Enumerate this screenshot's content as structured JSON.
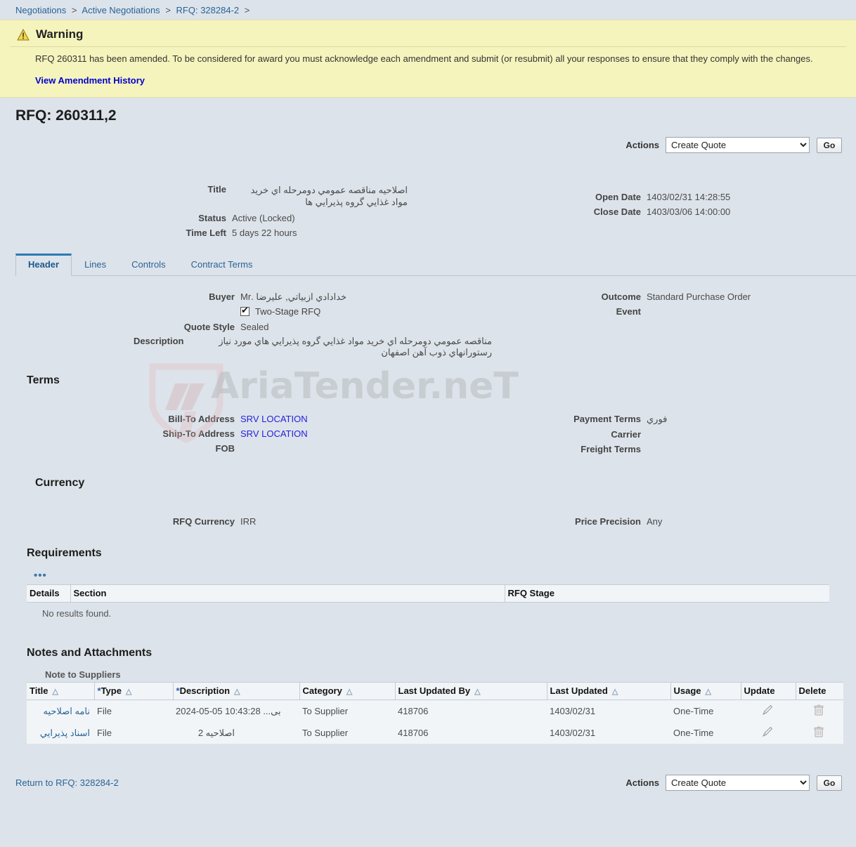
{
  "breadcrumb": {
    "items": [
      {
        "label": "Negotiations"
      },
      {
        "label": "Active Negotiations"
      },
      {
        "label": "RFQ: 328284-2"
      }
    ],
    "separator": ">"
  },
  "warning": {
    "icon": "warning-triangle-icon",
    "heading": "Warning",
    "message": "RFQ 260311 has been amended. To be considered for award you must acknowledge each amendment and submit (or resubmit) all your responses to ensure that they comply with the changes.",
    "link_label": "View Amendment History",
    "background_color": "#f5f4bd"
  },
  "page": {
    "title": "RFQ: 260311,2"
  },
  "actions_top": {
    "label": "Actions",
    "selected": "Create Quote",
    "options": [
      "Create Quote"
    ],
    "go_label": "Go"
  },
  "summary": {
    "left": [
      {
        "label": "Title",
        "value": "اصلاحیه مناقصه عمومي دومرحله اي خريد مواد غذايي گروه پذيرايي ها",
        "rtl": true
      },
      {
        "label": "Status",
        "value": "Active (Locked)",
        "rtl": false
      },
      {
        "label": "Time Left",
        "value": "5 days 22 hours",
        "rtl": false
      }
    ],
    "right": [
      {
        "label": "Open Date",
        "value": "1403/02/31 14:28:55"
      },
      {
        "label": "Close Date",
        "value": "1403/03/06 14:00:00"
      }
    ]
  },
  "tabs": [
    {
      "label": "Header",
      "active": true
    },
    {
      "label": "Lines",
      "active": false
    },
    {
      "label": "Controls",
      "active": false
    },
    {
      "label": "Contract Terms",
      "active": false
    }
  ],
  "header_details": {
    "left": [
      {
        "label": "Buyer",
        "value": "خدادادي ازبياتي, علیرضا .Mr",
        "rtl": true
      },
      {
        "label": "Quote Style",
        "value": "Sealed",
        "rtl": false
      },
      {
        "label": "Description",
        "value": "مناقصه عمومي دومرحله اي خريد مواد غذايي گروه پذيرايي هاي مورد نياز رستورانهاي ذوب آهن اصفهان",
        "rtl": true
      }
    ],
    "checkbox": {
      "label": "Two-Stage RFQ",
      "checked": true
    },
    "right": [
      {
        "label": "Outcome",
        "value": "Standard Purchase Order"
      },
      {
        "label": "Event",
        "value": ""
      }
    ]
  },
  "terms": {
    "heading": "Terms",
    "left": [
      {
        "label": "Bill-To Address",
        "value": "SRV LOCATION",
        "is_link": true
      },
      {
        "label": "Ship-To Address",
        "value": "SRV LOCATION",
        "is_link": true
      },
      {
        "label": "FOB",
        "value": "",
        "is_link": false
      }
    ],
    "right": [
      {
        "label": "Payment Terms",
        "value": "فوري",
        "rtl": true
      },
      {
        "label": "Carrier",
        "value": "",
        "rtl": false
      },
      {
        "label": "Freight Terms",
        "value": "",
        "rtl": false
      }
    ]
  },
  "currency": {
    "heading": "Currency",
    "left": [
      {
        "label": "RFQ Currency",
        "value": "IRR"
      }
    ],
    "right": [
      {
        "label": "Price Precision",
        "value": "Any"
      }
    ]
  },
  "requirements": {
    "heading": "Requirements",
    "more_icon": "ellipsis-icon",
    "columns": [
      "Details",
      "Section",
      "RFQ Stage"
    ],
    "empty_message": "No results found."
  },
  "notes_attachments": {
    "heading": "Notes and Attachments",
    "subheading": "Note to Suppliers",
    "columns": [
      {
        "label": "Title",
        "required": false,
        "sortable": true
      },
      {
        "label": "Type",
        "required": true,
        "sortable": true
      },
      {
        "label": "Description",
        "required": true,
        "sortable": true
      },
      {
        "label": "Category",
        "required": false,
        "sortable": true
      },
      {
        "label": "Last Updated By",
        "required": false,
        "sortable": true
      },
      {
        "label": "Last Updated",
        "required": false,
        "sortable": true
      },
      {
        "label": "Usage",
        "required": false,
        "sortable": true
      },
      {
        "label": "Update",
        "required": false,
        "sortable": false
      },
      {
        "label": "Delete",
        "required": false,
        "sortable": false
      }
    ],
    "rows": [
      {
        "title": "نامه اصلاحیه",
        "type": "File",
        "description": "2024-05-05 10:43:28 ...بی",
        "category": "To Supplier",
        "last_updated_by": "418706",
        "last_updated": "1403/02/31",
        "usage": "One-Time",
        "update_icon": "pencil-icon",
        "delete_icon": "trash-icon"
      },
      {
        "title": "اسناد پذيرايي",
        "type": "File",
        "description": "اصلاحیه 2",
        "category": "To Supplier",
        "last_updated_by": "418706",
        "last_updated": "1403/02/31",
        "usage": "One-Time",
        "update_icon": "pencil-icon",
        "delete_icon": "trash-icon"
      }
    ]
  },
  "footer": {
    "return_link": "Return to RFQ: 328284-2",
    "actions_label": "Actions",
    "actions_selected": "Create Quote",
    "actions_options": [
      "Create Quote"
    ],
    "go_label": "Go"
  },
  "watermark": {
    "text": "AriaTender.neT",
    "color": "#b8bcc0"
  }
}
